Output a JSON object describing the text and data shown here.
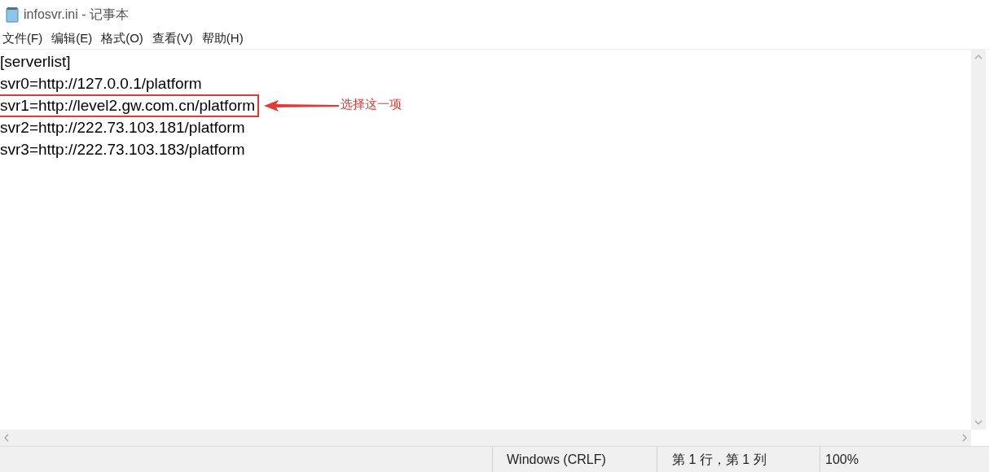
{
  "window": {
    "title": "infosvr.ini - 记事本"
  },
  "menu": [
    {
      "label": "文件(F)"
    },
    {
      "label": "编辑(E)"
    },
    {
      "label": "格式(O)"
    },
    {
      "label": "查看(V)"
    },
    {
      "label": "帮助(H)"
    }
  ],
  "lines": [
    {
      "text": "[serverlist]",
      "highlighted": false
    },
    {
      "text": "svr0=http://127.0.0.1/platform",
      "highlighted": false
    },
    {
      "text": "svr1=http://level2.gw.com.cn/platform",
      "highlighted": true
    },
    {
      "text": "svr2=http://222.73.103.181/platform",
      "highlighted": false
    },
    {
      "text": "svr3=http://222.73.103.183/platform",
      "highlighted": false
    }
  ],
  "annotation": {
    "text": "选择这一项"
  },
  "status_bar": {
    "line_ending": "Windows (CRLF)",
    "position": "第 1 行，第 1 列",
    "zoom": "100%"
  }
}
